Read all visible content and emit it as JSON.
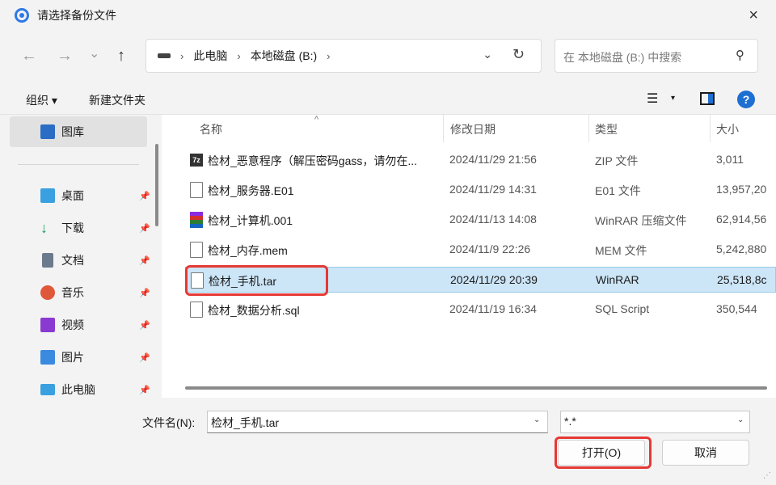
{
  "window": {
    "title": "请选择备份文件",
    "close_icon": "×"
  },
  "nav": {
    "back_icon": "←",
    "forward_icon": "→",
    "recent_icon": "⌄",
    "up_icon": "↑",
    "breadcrumb": [
      "此电脑",
      "本地磁盘 (B:)"
    ],
    "dropdown_icon": "⌄",
    "refresh_icon": "↻"
  },
  "search": {
    "placeholder": "在 本地磁盘 (B:) 中搜索",
    "icon": "⚲"
  },
  "toolbar": {
    "organize_label": "组织 ▾",
    "new_folder_label": "新建文件夹",
    "view_icon": "☰",
    "view_dd_icon": "▾",
    "help_icon": "?"
  },
  "sidebar": {
    "items": [
      {
        "label": "图库",
        "icon": "gallery-icon",
        "color": "#2b6cc4"
      },
      {
        "label": "桌面",
        "icon": "desktop-icon",
        "color": "#3aa0e0"
      },
      {
        "label": "下载",
        "icon": "download-icon",
        "color": "#1a9a5a"
      },
      {
        "label": "文档",
        "icon": "documents-icon",
        "color": "#6b7b8c"
      },
      {
        "label": "音乐",
        "icon": "music-icon",
        "color": "#e0583a"
      },
      {
        "label": "视频",
        "icon": "video-icon",
        "color": "#8a3ad0"
      },
      {
        "label": "图片",
        "icon": "pictures-icon",
        "color": "#3a8ae0"
      },
      {
        "label": "此电脑",
        "icon": "this-pc-icon",
        "color": "#3aa0e0"
      }
    ],
    "pin_icon": "📌"
  },
  "columns": {
    "name": "名称",
    "date": "修改日期",
    "type": "类型",
    "size": "大小",
    "sort_caret": "^"
  },
  "files": [
    {
      "name": "检材_恶意程序（解压密码gass，请勿在...",
      "date": "2024/11/29 21:56",
      "type": "ZIP 文件",
      "size": "3,011",
      "icon": "zip-icon",
      "icon_text": "7z"
    },
    {
      "name": "检材_服务器.E01",
      "date": "2024/11/29 14:31",
      "type": "E01 文件",
      "size": "13,957,20",
      "icon": "file-icon"
    },
    {
      "name": "检材_计算机.001",
      "date": "2024/11/13 14:08",
      "type": "WinRAR 压缩文件",
      "size": "62,914,56",
      "icon": "winrar-icon"
    },
    {
      "name": "检材_内存.mem",
      "date": "2024/11/9 22:26",
      "type": "MEM 文件",
      "size": "5,242,880",
      "icon": "file-icon"
    },
    {
      "name": "检材_手机.tar",
      "date": "2024/11/29 20:39",
      "type": "WinRAR",
      "size": "25,518,8c",
      "icon": "file-icon",
      "selected": true
    },
    {
      "name": "检材_数据分析.sql",
      "date": "2024/11/19 16:34",
      "type": "SQL Script",
      "size": "350,544",
      "icon": "file-icon"
    }
  ],
  "footer": {
    "filename_label": "文件名(N):",
    "filename_value": "检材_手机.tar",
    "filetype_value": "*.*",
    "dd_icon": "⌄",
    "open_label": "打开(O)",
    "cancel_label": "取消"
  },
  "colors": {
    "accent": "#1e6fd2",
    "selection": "#cce5f7",
    "highlight_annotation": "#e53935"
  }
}
